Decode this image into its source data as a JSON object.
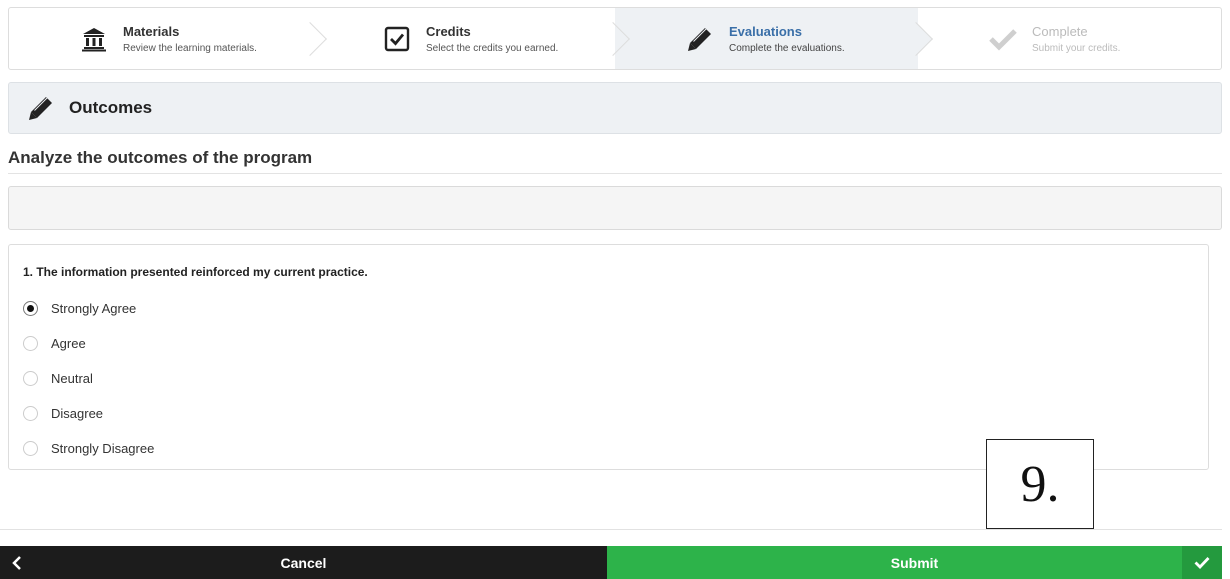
{
  "stepper": {
    "steps": [
      {
        "title": "Materials",
        "subtitle": "Review the learning materials.",
        "icon": "institution-icon",
        "state": "done"
      },
      {
        "title": "Credits",
        "subtitle": "Select the credits you earned.",
        "icon": "checkbox-icon",
        "state": "done"
      },
      {
        "title": "Evaluations",
        "subtitle": "Complete the evaluations.",
        "icon": "pencil-icon",
        "state": "active"
      },
      {
        "title": "Complete",
        "subtitle": "Submit your credits.",
        "icon": "check-icon",
        "state": "disabled"
      }
    ]
  },
  "section": {
    "title": "Outcomes",
    "icon": "pencil-icon"
  },
  "page_title": "Analyze the outcomes of the program",
  "question": {
    "text": "1. The information presented reinforced my current practice.",
    "selected": "Strongly Agree",
    "options": [
      "Strongly Agree",
      "Agree",
      "Neutral",
      "Disagree",
      "Strongly Disagree"
    ]
  },
  "annotation": "9.",
  "footer": {
    "cancel_label": "Cancel",
    "submit_label": "Submit",
    "back_icon": "chevron-left-icon",
    "confirm_icon": "check-icon"
  },
  "colors": {
    "accent": "#3a6fa8",
    "submit": "#2db34a",
    "cancel": "#1c1c1c",
    "panel": "#eef1f4"
  }
}
